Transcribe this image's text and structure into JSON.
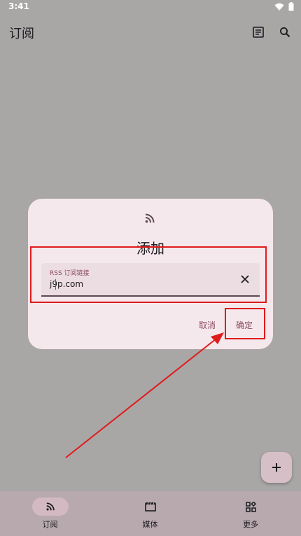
{
  "status": {
    "time": "3:41"
  },
  "app_bar": {
    "title": "订阅"
  },
  "dialog": {
    "title": "添加",
    "field_label": "RSS 订阅链接",
    "field_value": "j9p.com",
    "cancel": "取消",
    "confirm": "确定"
  },
  "bottom_nav": [
    {
      "label": "订阅",
      "active": true
    },
    {
      "label": "媒体",
      "active": false
    },
    {
      "label": "更多",
      "active": false
    }
  ],
  "colors": {
    "accent": "#8d4b63",
    "annotation": "#e01b1b",
    "scrim": "#a9a6a6"
  }
}
